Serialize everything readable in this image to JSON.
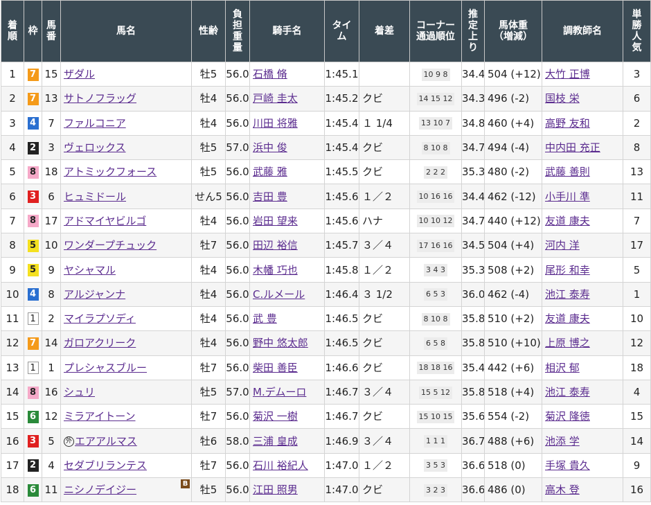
{
  "headers": {
    "rank": "着\n順",
    "waku": "枠",
    "number": "馬\n番",
    "horse": "馬名",
    "sex_age": "性齢",
    "weight": "負\n担\n重\n量",
    "jockey": "騎手名",
    "time": "タイ\nム",
    "margin": "着差",
    "corner": "コーナー\n通過順位",
    "last3f": "推\n定\n上\nり",
    "body_weight": "馬体重\n（増減）",
    "trainer": "調教師名",
    "popularity": "単\n勝\n人\n気"
  },
  "markers": {
    "foreign": "外",
    "blinker": "B"
  },
  "colors": {
    "header_bg": "#3a4a54",
    "link": "#5b2c8f",
    "stripe": "#f5f5f5"
  },
  "rows": [
    {
      "rank": "1",
      "waku": "7",
      "number": "15",
      "horse": "ザダル",
      "foreign": false,
      "blinker": false,
      "sex_age": "牡5",
      "weight": "56.0",
      "jockey": "石橋 脩",
      "time": "1:45.1",
      "margin": "",
      "corner": "10 9 8",
      "last3f": "34.4",
      "body_weight": "504 (+12)",
      "trainer": "大竹 正博",
      "popularity": "3"
    },
    {
      "rank": "2",
      "waku": "7",
      "number": "13",
      "horse": "サトノフラッグ",
      "foreign": false,
      "blinker": false,
      "sex_age": "牡4",
      "weight": "56.0",
      "jockey": "戸崎 圭太",
      "time": "1:45.2",
      "margin": "クビ",
      "corner": "14 15 12",
      "last3f": "34.3",
      "body_weight": "496 (-2)",
      "trainer": "国枝 栄",
      "popularity": "6"
    },
    {
      "rank": "3",
      "waku": "4",
      "number": "7",
      "horse": "ファルコニア",
      "foreign": false,
      "blinker": false,
      "sex_age": "牡4",
      "weight": "56.0",
      "jockey": "川田 将雅",
      "time": "1:45.4",
      "margin": "１ 1/4",
      "corner": "13 10 7",
      "last3f": "34.8",
      "body_weight": "460 (+4)",
      "trainer": "高野 友和",
      "popularity": "2"
    },
    {
      "rank": "4",
      "waku": "2",
      "number": "3",
      "horse": "ヴェロックス",
      "foreign": false,
      "blinker": false,
      "sex_age": "牡5",
      "weight": "57.0",
      "jockey": "浜中 俊",
      "time": "1:45.4",
      "margin": "クビ",
      "corner": "8 10 8",
      "last3f": "34.7",
      "body_weight": "494 (-4)",
      "trainer": "中内田 充正",
      "popularity": "8"
    },
    {
      "rank": "5",
      "waku": "8",
      "number": "18",
      "horse": "アトミックフォース",
      "foreign": false,
      "blinker": false,
      "sex_age": "牡5",
      "weight": "56.0",
      "jockey": "武藤 雅",
      "time": "1:45.5",
      "margin": "クビ",
      "corner": "2 2 2",
      "last3f": "35.3",
      "body_weight": "480 (-2)",
      "trainer": "武藤 善則",
      "popularity": "13"
    },
    {
      "rank": "6",
      "waku": "3",
      "number": "6",
      "horse": "ヒュミドール",
      "foreign": false,
      "blinker": false,
      "sex_age": "せん5",
      "weight": "56.0",
      "jockey": "吉田 豊",
      "time": "1:45.6",
      "margin": "１／２",
      "corner": "10 16 16",
      "last3f": "34.4",
      "body_weight": "462 (-12)",
      "trainer": "小手川 準",
      "popularity": "11"
    },
    {
      "rank": "7",
      "waku": "8",
      "number": "17",
      "horse": "アドマイヤビルゴ",
      "foreign": false,
      "blinker": false,
      "sex_age": "牡4",
      "weight": "56.0",
      "jockey": "岩田 望来",
      "time": "1:45.6",
      "margin": "ハナ",
      "corner": "10 10 12",
      "last3f": "34.7",
      "body_weight": "440 (+12)",
      "trainer": "友道 康夫",
      "popularity": "7"
    },
    {
      "rank": "8",
      "waku": "5",
      "number": "10",
      "horse": "ワンダープチュック",
      "foreign": false,
      "blinker": false,
      "sex_age": "牡7",
      "weight": "56.0",
      "jockey": "田辺 裕信",
      "time": "1:45.7",
      "margin": "３／４",
      "corner": "17 16 16",
      "last3f": "34.5",
      "body_weight": "504 (+4)",
      "trainer": "河内 洋",
      "popularity": "17"
    },
    {
      "rank": "9",
      "waku": "5",
      "number": "9",
      "horse": "ヤシャマル",
      "foreign": false,
      "blinker": false,
      "sex_age": "牡4",
      "weight": "56.0",
      "jockey": "木幡 巧也",
      "time": "1:45.8",
      "margin": "１／２",
      "corner": "3 4 3",
      "last3f": "35.3",
      "body_weight": "508 (+2)",
      "trainer": "尾形 和幸",
      "popularity": "5"
    },
    {
      "rank": "10",
      "waku": "4",
      "number": "8",
      "horse": "アルジャンナ",
      "foreign": false,
      "blinker": false,
      "sex_age": "牡4",
      "weight": "56.0",
      "jockey": "C.ルメール",
      "time": "1:46.4",
      "margin": "３ 1/2",
      "corner": "6 5 3",
      "last3f": "36.0",
      "body_weight": "462 (-4)",
      "trainer": "池江 泰寿",
      "popularity": "1"
    },
    {
      "rank": "11",
      "waku": "1",
      "number": "2",
      "horse": "マイラプソディ",
      "foreign": false,
      "blinker": false,
      "sex_age": "牡4",
      "weight": "56.0",
      "jockey": "武 豊",
      "time": "1:46.5",
      "margin": "クビ",
      "corner": "8 10 8",
      "last3f": "35.8",
      "body_weight": "510 (+2)",
      "trainer": "友道 康夫",
      "popularity": "10"
    },
    {
      "rank": "12",
      "waku": "7",
      "number": "14",
      "horse": "ガロアクリーク",
      "foreign": false,
      "blinker": false,
      "sex_age": "牡4",
      "weight": "56.0",
      "jockey": "野中 悠太郎",
      "time": "1:46.5",
      "margin": "クビ",
      "corner": "6 5 8",
      "last3f": "35.8",
      "body_weight": "510 (+10)",
      "trainer": "上原 博之",
      "popularity": "12"
    },
    {
      "rank": "13",
      "waku": "1",
      "number": "1",
      "horse": "プレシャスブルー",
      "foreign": false,
      "blinker": false,
      "sex_age": "牡7",
      "weight": "56.0",
      "jockey": "柴田 善臣",
      "time": "1:46.6",
      "margin": "クビ",
      "corner": "18 18 16",
      "last3f": "35.4",
      "body_weight": "442 (+6)",
      "trainer": "相沢 郁",
      "popularity": "18"
    },
    {
      "rank": "14",
      "waku": "8",
      "number": "16",
      "horse": "シュリ",
      "foreign": false,
      "blinker": false,
      "sex_age": "牡5",
      "weight": "57.0",
      "jockey": "M.デムーロ",
      "time": "1:46.7",
      "margin": "３／４",
      "corner": "15 5 12",
      "last3f": "35.8",
      "body_weight": "518 (+4)",
      "trainer": "池江 泰寿",
      "popularity": "4"
    },
    {
      "rank": "15",
      "waku": "6",
      "number": "12",
      "horse": "ミラアイトーン",
      "foreign": false,
      "blinker": false,
      "sex_age": "牡7",
      "weight": "56.0",
      "jockey": "菊沢 一樹",
      "time": "1:46.7",
      "margin": "クビ",
      "corner": "15 10 15",
      "last3f": "35.6",
      "body_weight": "554 (-2)",
      "trainer": "菊沢 隆徳",
      "popularity": "15"
    },
    {
      "rank": "16",
      "waku": "3",
      "number": "5",
      "horse": "エアアルマス",
      "foreign": true,
      "blinker": false,
      "sex_age": "牡6",
      "weight": "58.0",
      "jockey": "三浦 皇成",
      "time": "1:46.9",
      "margin": "３／４",
      "corner": "1 1 1",
      "last3f": "36.7",
      "body_weight": "488 (+6)",
      "trainer": "池添 学",
      "popularity": "14"
    },
    {
      "rank": "17",
      "waku": "2",
      "number": "4",
      "horse": "セダブリランテス",
      "foreign": false,
      "blinker": false,
      "sex_age": "牡7",
      "weight": "56.0",
      "jockey": "石川 裕紀人",
      "time": "1:47.0",
      "margin": "１／２",
      "corner": "3 5 3",
      "last3f": "36.6",
      "body_weight": "518 (0)",
      "trainer": "手塚 貴久",
      "popularity": "9"
    },
    {
      "rank": "18",
      "waku": "6",
      "number": "11",
      "horse": "ニシノデイジー",
      "foreign": false,
      "blinker": true,
      "sex_age": "牡5",
      "weight": "56.0",
      "jockey": "江田 照男",
      "time": "1:47.0",
      "margin": "クビ",
      "corner": "3 2 3",
      "last3f": "36.6",
      "body_weight": "486 (0)",
      "trainer": "高木 登",
      "popularity": "16"
    }
  ]
}
